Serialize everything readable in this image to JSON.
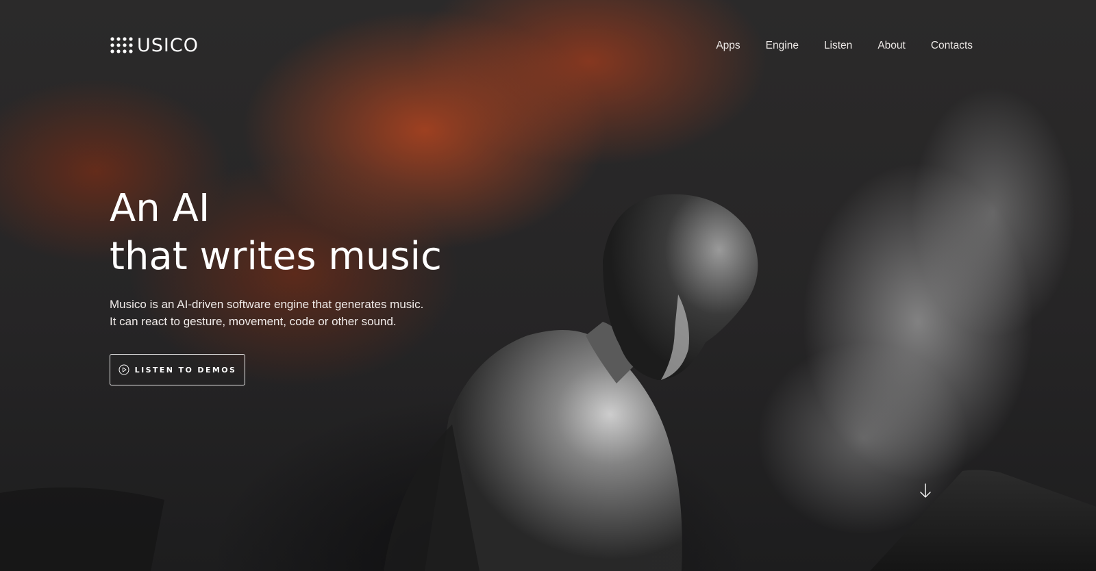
{
  "header": {
    "logo_text": "USICO",
    "nav": [
      {
        "label": "Apps"
      },
      {
        "label": "Engine"
      },
      {
        "label": "Listen"
      },
      {
        "label": "About"
      },
      {
        "label": "Contacts"
      }
    ]
  },
  "hero": {
    "headline_line1": "An AI",
    "headline_line2": "that writes music",
    "description_line1": "Musico is an AI-driven software engine that generates music.",
    "description_line2": "It can react to gesture, movement, code or other sound.",
    "cta_label": "LISTEN TO DEMOS",
    "cta_icon": "play-circle-icon",
    "scroll_icon": "arrow-down-icon"
  },
  "colors": {
    "text": "#ffffff",
    "accent_smoke": "#a84220",
    "background": "#262526"
  }
}
